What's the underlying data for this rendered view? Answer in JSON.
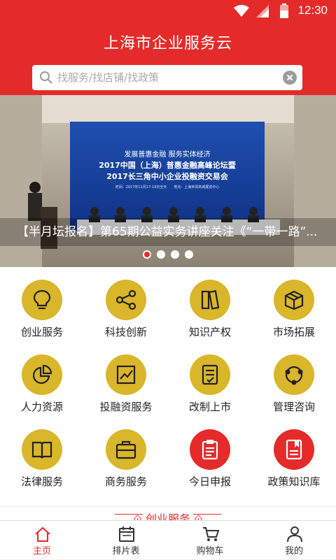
{
  "status_bar": {
    "time": "12:30"
  },
  "header": {
    "title": "上海市企业服务云"
  },
  "search": {
    "placeholder": "找服务/找店铺/找政策"
  },
  "banner": {
    "caption": "【半月坛报名】第65期公益实务讲座关注《“一带一路”...",
    "screen_line1": "发展普惠金融 服务实体经济",
    "screen_line2": "2017中国（上海）普惠金融高峰论坛暨",
    "screen_line3": "2017长三角中小企业投融资交易会",
    "screen_line4": "时间：2017年11月17-19日全天　　地点：上海世贸商城展览中心",
    "slides_total": 4,
    "active_slide": 1
  },
  "colors": {
    "brand_red": "#e52a2a",
    "icon_yellow": "#d9b62a",
    "icon_red": "#e52a2a"
  },
  "grid": {
    "items": [
      {
        "label": "创业服务",
        "icon": "lightbulb-icon",
        "color": "yellow"
      },
      {
        "label": "科技创新",
        "icon": "share-nodes-icon",
        "color": "yellow"
      },
      {
        "label": "知识产权",
        "icon": "books-icon",
        "color": "yellow"
      },
      {
        "label": "市场拓展",
        "icon": "box-icon",
        "color": "yellow"
      },
      {
        "label": "人力资源",
        "icon": "pie-chart-icon",
        "color": "yellow"
      },
      {
        "label": "投融资服务",
        "icon": "trend-chart-icon",
        "color": "yellow"
      },
      {
        "label": "改制上市",
        "icon": "checklist-icon",
        "color": "yellow"
      },
      {
        "label": "管理咨询",
        "icon": "network-icon",
        "color": "yellow"
      },
      {
        "label": "法律服务",
        "icon": "open-book-icon",
        "color": "yellow"
      },
      {
        "label": "商务服务",
        "icon": "briefcase-icon",
        "color": "yellow"
      },
      {
        "label": "今日申报",
        "icon": "clipboard-icon",
        "color": "red"
      },
      {
        "label": "政策知识库",
        "icon": "policy-book-icon",
        "color": "red"
      }
    ]
  },
  "section": {
    "title": "创业服务"
  },
  "tabs": [
    {
      "label": "主页",
      "icon": "home-icon",
      "active": true
    },
    {
      "label": "排片表",
      "icon": "calendar-icon",
      "active": false
    },
    {
      "label": "购物车",
      "icon": "cart-icon",
      "active": false
    },
    {
      "label": "我的",
      "icon": "user-icon",
      "active": false
    }
  ]
}
